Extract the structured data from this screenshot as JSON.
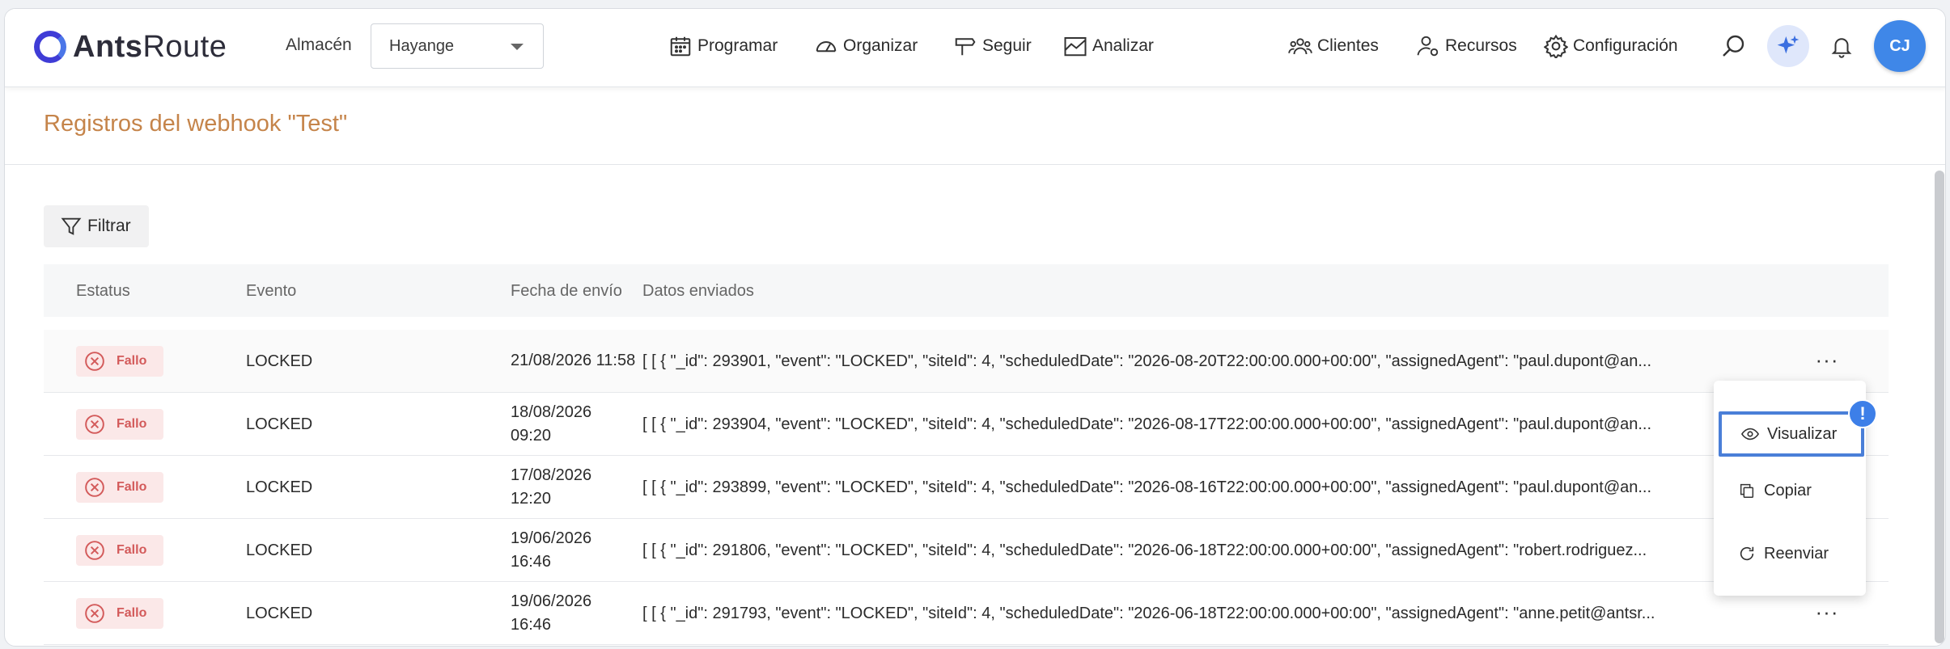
{
  "brand": {
    "name_bold": "Ants",
    "name_rest": "Route"
  },
  "warehouse": {
    "label": "Almacén",
    "value": "Hayange"
  },
  "nav": {
    "programar": "Programar",
    "organizar": "Organizar",
    "seguir": "Seguir",
    "analizar": "Analizar",
    "clientes": "Clientes",
    "recursos": "Recursos",
    "configuracion": "Configuración"
  },
  "user": {
    "initials": "CJ"
  },
  "page": {
    "title": "Registros del webhook \"Test\""
  },
  "filter": {
    "label": "Filtrar"
  },
  "table": {
    "headers": {
      "status": "Estatus",
      "event": "Evento",
      "date": "Fecha de envío",
      "data": "Datos enviados"
    },
    "rows": [
      {
        "status": "Fallo",
        "event": "LOCKED",
        "date_l1": "21/08/2026 11:58",
        "date_l2": "",
        "data": "[ [ { \"_id\": 293901, \"event\": \"LOCKED\", \"siteId\": 4, \"scheduledDate\": \"2026-08-20T22:00:00.000+00:00\", \"assignedAgent\": \"paul.dupont@an..."
      },
      {
        "status": "Fallo",
        "event": "LOCKED",
        "date_l1": "18/08/2026",
        "date_l2": "09:20",
        "data": "[ [ { \"_id\": 293904, \"event\": \"LOCKED\", \"siteId\": 4, \"scheduledDate\": \"2026-08-17T22:00:00.000+00:00\", \"assignedAgent\": \"paul.dupont@an..."
      },
      {
        "status": "Fallo",
        "event": "LOCKED",
        "date_l1": "17/08/2026",
        "date_l2": "12:20",
        "data": "[ [ { \"_id\": 293899, \"event\": \"LOCKED\", \"siteId\": 4, \"scheduledDate\": \"2026-08-16T22:00:00.000+00:00\", \"assignedAgent\": \"paul.dupont@an..."
      },
      {
        "status": "Fallo",
        "event": "LOCKED",
        "date_l1": "19/06/2026",
        "date_l2": "16:46",
        "data": "[ [ { \"_id\": 291806, \"event\": \"LOCKED\", \"siteId\": 4, \"scheduledDate\": \"2026-06-18T22:00:00.000+00:00\", \"assignedAgent\": \"robert.rodriguez..."
      },
      {
        "status": "Fallo",
        "event": "LOCKED",
        "date_l1": "19/06/2026",
        "date_l2": "16:46",
        "data": "[ [ { \"_id\": 291793, \"event\": \"LOCKED\", \"siteId\": 4, \"scheduledDate\": \"2026-06-18T22:00:00.000+00:00\", \"assignedAgent\": \"anne.petit@antsr..."
      }
    ],
    "row_menu_glyph": "···"
  },
  "context_menu": {
    "visualizar": "Visualizar",
    "copiar": "Copiar",
    "reenviar": "Reenviar",
    "alert_glyph": "!"
  },
  "colors": {
    "accent": "#3f87e8",
    "title": "#c5844a",
    "fail": "#d35a5a",
    "fail_bg": "#fbe8e8"
  }
}
